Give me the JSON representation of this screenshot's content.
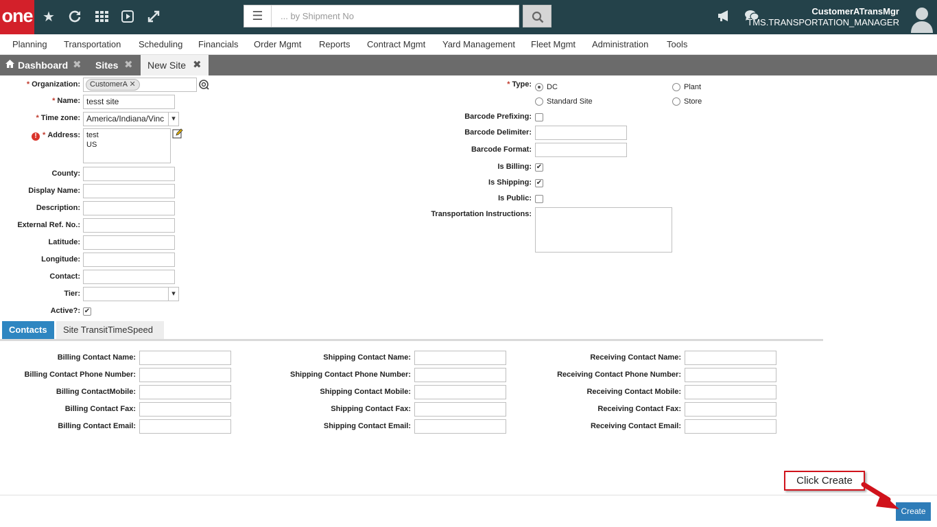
{
  "topbar": {
    "logo": "one",
    "icons": [
      "star-icon",
      "refresh-icon",
      "grid-icon",
      "play-icon",
      "expand-icon",
      "megaphone-icon",
      "chat-icon",
      "user-avatar-icon"
    ],
    "search_placeholder": "... by Shipment No",
    "user_name": "CustomerATransMgr",
    "user_role": "TMS.TRANSPORTATION_MANAGER"
  },
  "menu": [
    "Planning",
    "Transportation",
    "Scheduling",
    "Financials",
    "Order Mgmt",
    "Reports",
    "Contract Mgmt",
    "Yard Management",
    "Fleet Mgmt",
    "Administration",
    "Tools"
  ],
  "tabs": [
    {
      "label": "Dashboard"
    },
    {
      "label": "Sites"
    },
    {
      "label": "New Site"
    }
  ],
  "form": {
    "organization_label": "Organization:",
    "organization_value": "CustomerA",
    "name_label": "Name:",
    "name_value": "tesst site",
    "timezone_label": "Time zone:",
    "timezone_value": "America/Indiana/Vinc",
    "address_label": "Address:",
    "address_line1": "test",
    "address_line2": "US",
    "county_label": "County:",
    "display_name_label": "Display Name:",
    "description_label": "Description:",
    "external_ref_label": "External Ref. No.:",
    "latitude_label": "Latitude:",
    "longitude_label": "Longitude:",
    "contact_label": "Contact:",
    "tier_label": "Tier:",
    "active_label": "Active?:",
    "type_label": "Type:",
    "type_options": [
      "DC",
      "Plant",
      "Standard Site",
      "Store"
    ],
    "type_selected": "DC",
    "barcode_prefixing_label": "Barcode Prefixing:",
    "barcode_delimiter_label": "Barcode Delimiter:",
    "barcode_format_label": "Barcode Format:",
    "is_billing_label": "Is Billing:",
    "is_shipping_label": "Is Shipping:",
    "is_public_label": "Is Public:",
    "transport_instr_label": "Transportation Instructions:",
    "checked": {
      "active": true,
      "is_billing": true,
      "is_shipping": true,
      "is_public": false,
      "barcode_prefixing": false
    }
  },
  "subtabs": [
    "Contacts",
    "Site TransitTimeSpeed"
  ],
  "contacts": {
    "billing": [
      "Billing Contact Name:",
      "Billing Contact Phone Number:",
      "Billing ContactMobile:",
      "Billing Contact Fax:",
      "Billing Contact Email:"
    ],
    "shipping": [
      "Shipping Contact Name:",
      "Shipping Contact Phone Number:",
      "Shipping Contact Mobile:",
      "Shipping Contact Fax:",
      "Shipping Contact Email:"
    ],
    "receiving": [
      "Receiving Contact Name:",
      "Receiving Contact Phone Number:",
      "Receiving Contact Mobile:",
      "Receiving Contact Fax:",
      "Receiving Contact Email:"
    ]
  },
  "create_label": "Create",
  "callout_text": "Click Create",
  "colors": {
    "topbar": "#24424a",
    "logo": "#d3202a",
    "accent": "#2e86c1",
    "tabbar": "#6b6b6b",
    "callout": "#d0121b"
  }
}
